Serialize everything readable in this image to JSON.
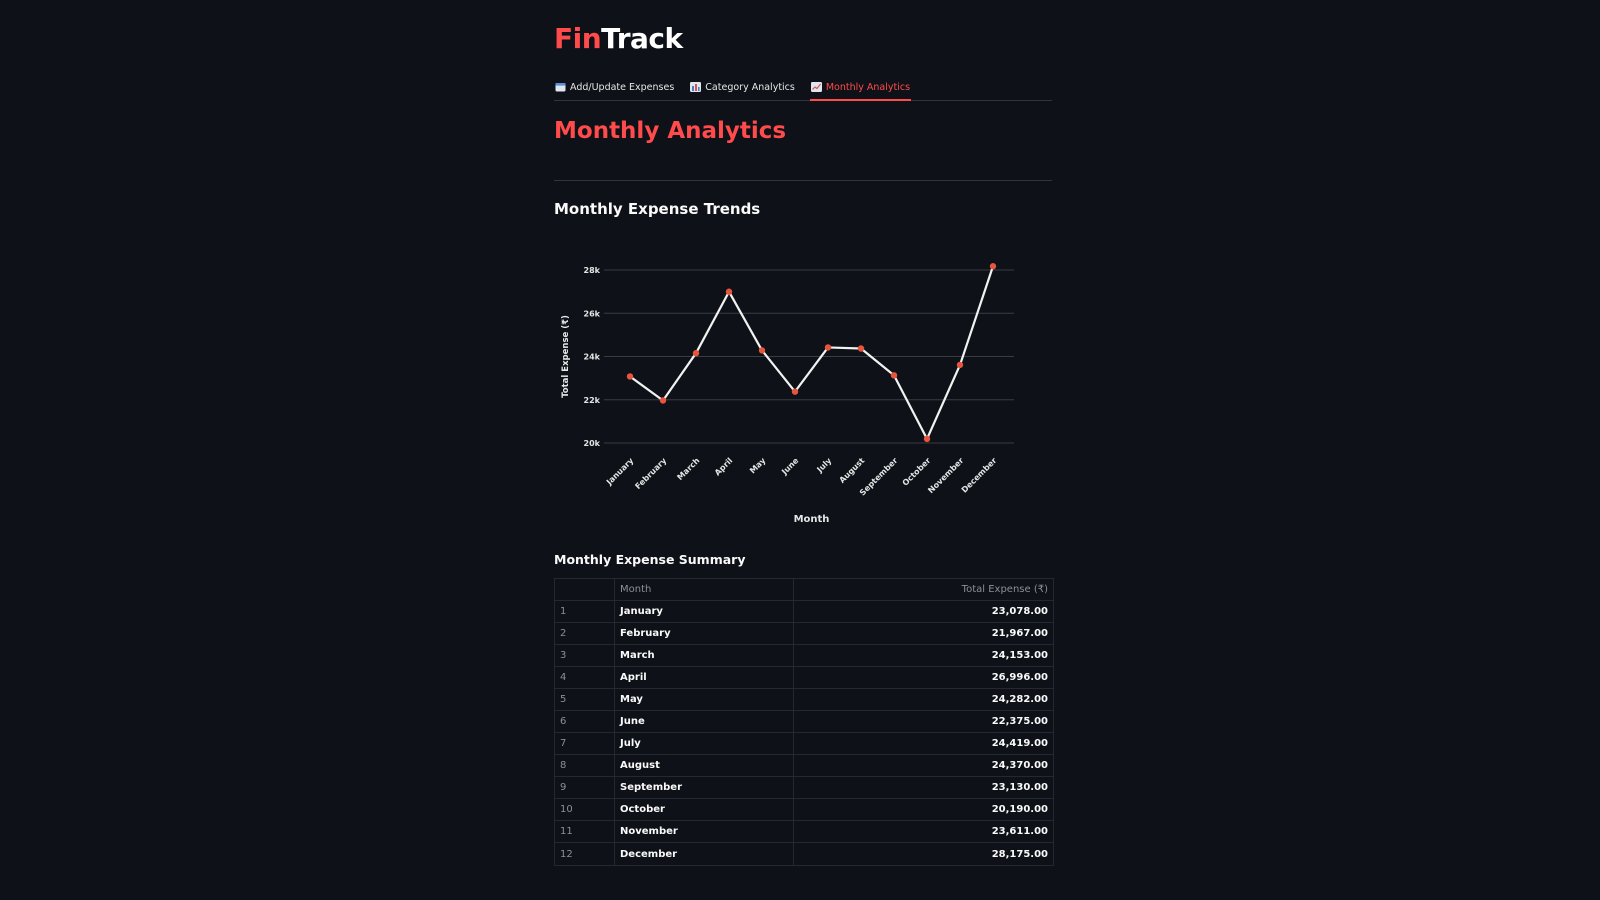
{
  "app": {
    "brand_part1": "Fin",
    "brand_part2": "Track"
  },
  "tabs": [
    {
      "label": "Add/Update Expenses",
      "icon": "calendar-icon",
      "active": false
    },
    {
      "label": "Category Analytics",
      "icon": "bar-chart-icon",
      "active": false
    },
    {
      "label": "Monthly Analytics",
      "icon": "line-chart-icon",
      "active": true
    }
  ],
  "page": {
    "title": "Monthly Analytics",
    "trends_title": "Monthly Expense Trends",
    "summary_title": "Monthly Expense Summary"
  },
  "colors": {
    "accent": "#ff4b4b",
    "background": "#0e1117",
    "line": "#f2f2f2",
    "marker": "#e8553d",
    "grid": "#3a3c44"
  },
  "chart_data": {
    "type": "line",
    "title": "",
    "xlabel": "Month",
    "ylabel": "Total Expense (₹)",
    "categories": [
      "January",
      "February",
      "March",
      "April",
      "May",
      "June",
      "July",
      "August",
      "September",
      "October",
      "November",
      "December"
    ],
    "values": [
      23078,
      21967,
      24153,
      26996,
      24282,
      22375,
      24419,
      24370,
      23130,
      20190,
      23611,
      28175
    ],
    "ylim": [
      20000,
      28000
    ],
    "yticks": [
      20000,
      22000,
      24000,
      26000,
      28000
    ],
    "ytick_labels": [
      "20k",
      "22k",
      "24k",
      "26k",
      "28k"
    ],
    "grid": true,
    "legend": "none"
  },
  "table": {
    "headers": [
      "",
      "Month",
      "Total Expense (₹)"
    ],
    "rows": [
      {
        "index": "1",
        "month": "January",
        "total": "23,078.00"
      },
      {
        "index": "2",
        "month": "February",
        "total": "21,967.00"
      },
      {
        "index": "3",
        "month": "March",
        "total": "24,153.00"
      },
      {
        "index": "4",
        "month": "April",
        "total": "26,996.00"
      },
      {
        "index": "5",
        "month": "May",
        "total": "24,282.00"
      },
      {
        "index": "6",
        "month": "June",
        "total": "22,375.00"
      },
      {
        "index": "7",
        "month": "July",
        "total": "24,419.00"
      },
      {
        "index": "8",
        "month": "August",
        "total": "24,370.00"
      },
      {
        "index": "9",
        "month": "September",
        "total": "23,130.00"
      },
      {
        "index": "10",
        "month": "October",
        "total": "20,190.00"
      },
      {
        "index": "11",
        "month": "November",
        "total": "23,611.00"
      },
      {
        "index": "12",
        "month": "December",
        "total": "28,175.00"
      }
    ]
  }
}
